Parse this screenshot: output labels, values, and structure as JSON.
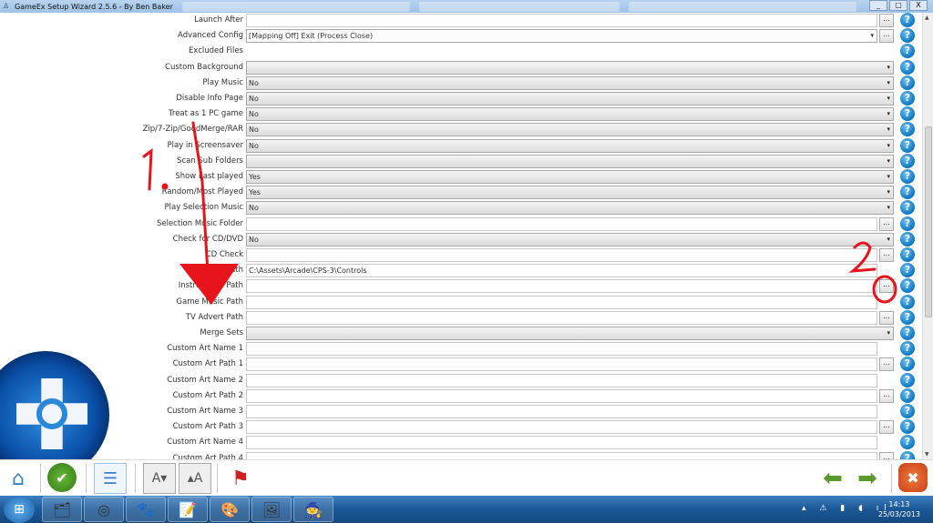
{
  "window": {
    "title": "GameEx Setup Wizard 2.5.6 - By Ben Baker",
    "minimize": "_",
    "maximize": "▢",
    "close": "X"
  },
  "rows": [
    {
      "label": "Launch After",
      "type": "text",
      "value": "",
      "browse": true
    },
    {
      "label": "Advanced Config",
      "type": "dropdown-browse",
      "value": "[Mapping Off] Exit (Process Close)",
      "browse": true
    },
    {
      "label": "Excluded Files",
      "type": "none",
      "value": ""
    },
    {
      "label": "Custom Background",
      "type": "dropdown",
      "value": ""
    },
    {
      "label": "Play Music",
      "type": "dropdown",
      "value": "No"
    },
    {
      "label": "Disable Info Page",
      "type": "dropdown",
      "value": "No"
    },
    {
      "label": "Treat as 1 PC game",
      "type": "dropdown",
      "value": "No"
    },
    {
      "label": "Zip/7-Zip/GoodMerge/RAR",
      "type": "dropdown",
      "value": "No"
    },
    {
      "label": "Play in Screensaver",
      "type": "dropdown",
      "value": "No"
    },
    {
      "label": "Scan Sub Folders",
      "type": "dropdown",
      "value": ""
    },
    {
      "label": "Show Last played",
      "type": "dropdown",
      "value": "Yes"
    },
    {
      "label": "Random/Most Played",
      "type": "dropdown",
      "value": "Yes"
    },
    {
      "label": "Play Selection Music",
      "type": "dropdown",
      "value": "No"
    },
    {
      "label": "Selection Music Folder",
      "type": "text",
      "value": "",
      "browse": true
    },
    {
      "label": "Check for CD/DVD",
      "type": "dropdown",
      "value": "No"
    },
    {
      "label": "CD Check",
      "type": "text",
      "value": "",
      "browse": true
    },
    {
      "label": "Controls Path",
      "type": "text",
      "value": "C:\\Assets\\Arcade\\CPS-3\\Controls",
      "browse": false
    },
    {
      "label": "Instructions Path",
      "type": "text",
      "value": "",
      "browse": true
    },
    {
      "label": "Game Music Path",
      "type": "text",
      "value": "",
      "browse": false
    },
    {
      "label": "TV Advert Path",
      "type": "text",
      "value": "",
      "browse": true
    },
    {
      "label": "Merge Sets",
      "type": "dropdown",
      "value": ""
    },
    {
      "label": "Custom Art Name 1",
      "type": "text",
      "value": "",
      "browse": false
    },
    {
      "label": "Custom Art Path 1",
      "type": "text",
      "value": "",
      "browse": true
    },
    {
      "label": "Custom Art Name 2",
      "type": "text",
      "value": "",
      "browse": false
    },
    {
      "label": "Custom Art Path 2",
      "type": "text",
      "value": "",
      "browse": true
    },
    {
      "label": "Custom Art Name 3",
      "type": "text",
      "value": "",
      "browse": false
    },
    {
      "label": "Custom Art Path 3",
      "type": "text",
      "value": "",
      "browse": true
    },
    {
      "label": "Custom Art Name 4",
      "type": "text",
      "value": "",
      "browse": false
    },
    {
      "label": "Custom Art Path 4",
      "type": "text",
      "value": "",
      "browse": true
    }
  ],
  "browse_label": "...",
  "help_label": "?",
  "dropdown_arrow": "▾",
  "toolbar": {
    "home": "⌂",
    "apply": "✔",
    "list_view": "☰",
    "font_smaller": "A▾",
    "font_larger": "▴A",
    "language": "⚑",
    "back": "⬅",
    "forward": "➡",
    "exit": "✖"
  },
  "taskbar": {
    "start": "⊞",
    "apps": [
      "🗂",
      "◎",
      "🐾",
      "📝",
      "🎨",
      "🖼",
      "🧙"
    ],
    "tray": "▴ ⚠ ▮ ◖ ıl",
    "time": "14:13",
    "date": "25/03/2013"
  },
  "annotations": {
    "step1": "1.",
    "step2": "2",
    "color": "#e8141c"
  }
}
